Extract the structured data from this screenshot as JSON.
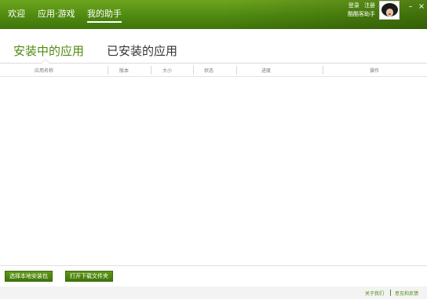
{
  "nav": {
    "items": [
      {
        "label": "欢迎"
      },
      {
        "label": "应用·游戏"
      },
      {
        "label": "我的助手"
      }
    ],
    "active_index": 2
  },
  "account": {
    "login": "登录",
    "register": "注册",
    "nickname": "酷酷客助手"
  },
  "window": {
    "minimize": "–",
    "close": "×"
  },
  "tabs": [
    {
      "label": "安装中的应用",
      "active": true
    },
    {
      "label": "已安装的应用",
      "active": false
    }
  ],
  "table": {
    "columns": [
      "应用名称",
      "版本",
      "大小",
      "状态",
      "进度",
      "操作"
    ],
    "rows": []
  },
  "footer": {
    "install_local_label": "选择本地安装包",
    "open_download_folder_label": "打开下载文件夹"
  },
  "statusbar": {
    "about": "关于我们",
    "feedback": "意见和反馈"
  },
  "colors": {
    "brand_green": "#4f8a10",
    "topbar_light": "#6ea51f"
  }
}
